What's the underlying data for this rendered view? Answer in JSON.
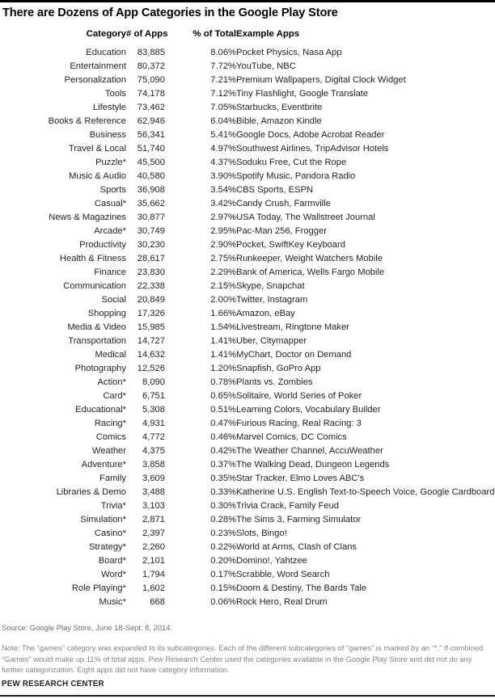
{
  "title": "There are Dozens of App Categories in the Google Play Store",
  "columns": {
    "category": "Category",
    "num_apps": "# of Apps",
    "pct_total": "% of Total",
    "example_apps": "Example Apps"
  },
  "source": "Source:  Google Play Store, June 18-Sept. 8, 2014.",
  "note": "Note: The “games” category was expanded to its subcategories. Each of the different subcategories of “games” is marked by an “*.” If combined “Games” would make up 11% of total apps. Pew Research Center used the categories available in the Google Play Store and did not do any further categorization. Eight apps did not have category information.",
  "brand": "PEW RESEARCH CENTER",
  "colors": {
    "rule": "#000000",
    "text": "#231f20",
    "muted": "#808285",
    "source": "#6d6e71",
    "background": "#ffffff"
  },
  "chart_data": {
    "type": "table",
    "title": "There are Dozens of App Categories in the Google Play Store",
    "columns": [
      "Category",
      "# of Apps",
      "% of Total",
      "Example Apps"
    ],
    "rows": [
      [
        "Education",
        "83,885",
        "8.06%",
        "Pocket Physics, Nasa App"
      ],
      [
        "Entertainment",
        "80,372",
        "7.72%",
        "YouTube, NBC"
      ],
      [
        "Personalization",
        "75,090",
        "7.21%",
        "Premium Wallpapers, Digital Clock Widget"
      ],
      [
        "Tools",
        "74,178",
        "7.12%",
        "Tiny Flashlight, Google Translate"
      ],
      [
        "Lifestyle",
        "73,462",
        "7.05%",
        "Starbucks, Eventbrite"
      ],
      [
        "Books & Reference",
        "62,946",
        "6.04%",
        "Bible, Amazon Kindle"
      ],
      [
        "Business",
        "56,341",
        "5.41%",
        "Google Docs, Adobe Acrobat Reader"
      ],
      [
        "Travel & Local",
        "51,740",
        "4.97%",
        "Southwest Airlines, TripAdvisor Hotels"
      ],
      [
        "Puzzle*",
        "45,500",
        "4.37%",
        "Soduku Free, Cut the Rope"
      ],
      [
        "Music & Audio",
        "40,580",
        "3.90%",
        "Spotify Music, Pandora Radio"
      ],
      [
        "Sports",
        "36,908",
        "3.54%",
        "CBS Sports, ESPN"
      ],
      [
        "Casual*",
        "35,662",
        "3.42%",
        "Candy Crush, Farmville"
      ],
      [
        "News & Magazines",
        "30,877",
        "2.97%",
        "USA Today, The Wallstreet Journal"
      ],
      [
        "Arcade*",
        "30,749",
        "2.95%",
        "Pac-Man 256, Frogger"
      ],
      [
        "Productivity",
        "30,230",
        "2.90%",
        "Pocket, SwiftKey Keyboard"
      ],
      [
        "Health & Fitness",
        "28,617",
        "2.75%",
        "Runkeeper, Weight Watchers Mobile"
      ],
      [
        "Finance",
        "23,830",
        "2.29%",
        "Bank of America, Wells Fargo Mobile"
      ],
      [
        "Communication",
        "22,338",
        "2.15%",
        "Skype, Snapchat"
      ],
      [
        "Social",
        "20,849",
        "2.00%",
        "Twitter, Instagram"
      ],
      [
        "Shopping",
        "17,326",
        "1.66%",
        "Amazon, eBay"
      ],
      [
        "Media & Video",
        "15,985",
        "1.54%",
        "Livestream, Ringtone Maker"
      ],
      [
        "Transportation",
        "14,727",
        "1.41%",
        "Uber, Citymapper"
      ],
      [
        "Medical",
        "14,632",
        "1.41%",
        "MyChart, Doctor on Demand"
      ],
      [
        "Photography",
        "12,526",
        "1.20%",
        "Snapfish, GoPro App"
      ],
      [
        "Action*",
        "8,090",
        "0.78%",
        "Plants vs. Zombies"
      ],
      [
        "Card*",
        "6,751",
        "0.65%",
        "Solitaire, World Series of Poker"
      ],
      [
        "Educational*",
        "5,308",
        "0.51%",
        "Learning Colors, Vocabulary Builder"
      ],
      [
        "Racing*",
        "4,931",
        "0.47%",
        "Furious Racing, Real Racing: 3"
      ],
      [
        "Comics",
        "4,772",
        "0.46%",
        "Marvel Comics, DC Comics"
      ],
      [
        "Weather",
        "4,375",
        "0.42%",
        "The Weather Channel, AccuWeather"
      ],
      [
        "Adventure*",
        "3,858",
        "0.37%",
        "The Walking Dead, Dungeon Legends"
      ],
      [
        "Family",
        "3,609",
        "0.35%",
        "Star Tracker, Elmo Loves ABC's"
      ],
      [
        "Libraries & Demo",
        "3,488",
        "0.33%",
        "Katherine U.S. English Text-to-Speech Voice, Google Cardboard"
      ],
      [
        "Trivia*",
        "3,103",
        "0.30%",
        "Trivia Crack, Family Feud"
      ],
      [
        "Simulation*",
        "2,871",
        "0.28%",
        "The Sims 3, Farming Simulator"
      ],
      [
        "Casino*",
        "2,397",
        "0.23%",
        "Slots, Bingo!"
      ],
      [
        "Strategy*",
        "2,260",
        "0.22%",
        "World at Arms, Clash of Clans"
      ],
      [
        "Board*",
        "2,101",
        "0.20%",
        "Domino!, Yahtzee"
      ],
      [
        "Word*",
        "1,794",
        "0.17%",
        "Scrabble, Word Search"
      ],
      [
        "Role Playing*",
        "1,602",
        "0.15%",
        "Doom & Destiny, The Bards Tale"
      ],
      [
        "Music*",
        "668",
        "0.06%",
        "Rock Hero, Real Drum"
      ]
    ]
  }
}
